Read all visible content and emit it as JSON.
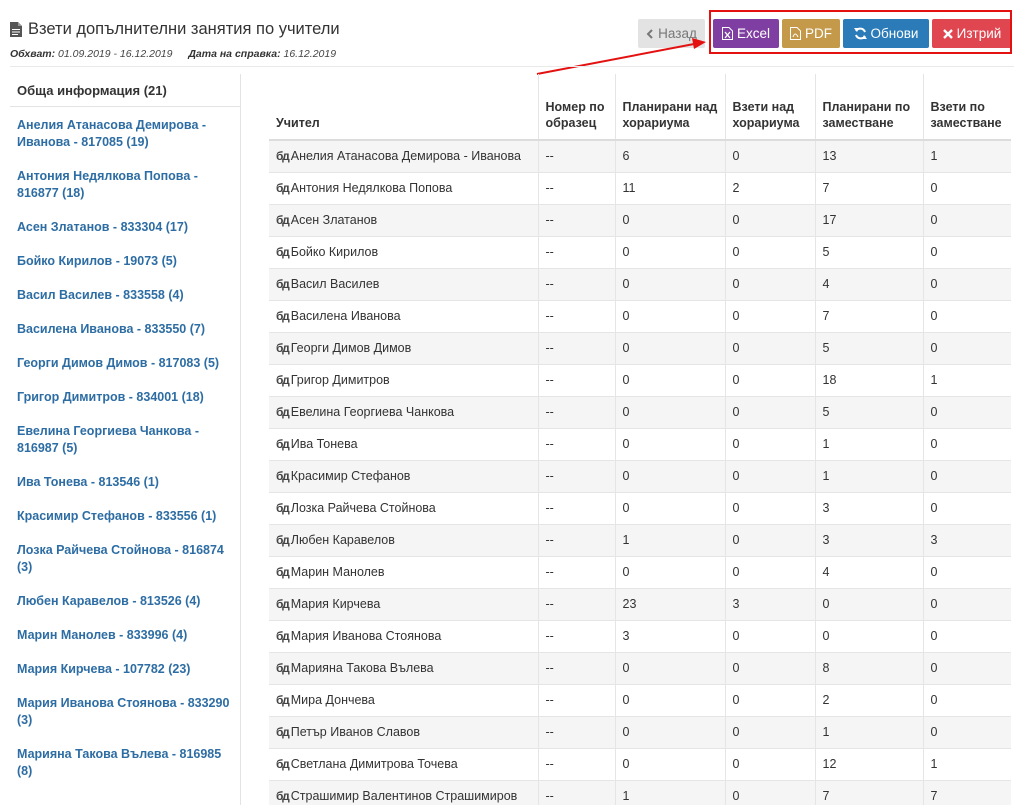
{
  "page": {
    "title": "Взети допълнителни занятия по учители",
    "range_label": "Обхват:",
    "range_value": "01.09.2019 - 16.12.2019",
    "date_label": "Дата на справка:",
    "date_value": "16.12.2019"
  },
  "toolbar": {
    "back_label": "Назад",
    "excel_label": "Excel",
    "pdf_label": "PDF",
    "refresh_label": "Обнови",
    "delete_label": "Изтрий"
  },
  "sidebar": {
    "header": "Обща информация (21)",
    "items": [
      "Анелия Атанасова Демирова - Иванова - 817085 (19)",
      "Антония Недялкова Попова - 816877 (18)",
      "Асен Златанов - 833304 (17)",
      "Бойко Кирилов - 19073 (5)",
      "Васил Василев - 833558 (4)",
      "Василена Иванова - 833550 (7)",
      "Георги Димов Димов - 817083 (5)",
      "Григор Димитров - 834001 (18)",
      "Евелина Георгиева Чанкова - 816987 (5)",
      "Ива Тонева - 813546 (1)",
      "Красимир Стефанов - 833556 (1)",
      "Лозка Райчева Стойнова - 816874 (3)",
      "Любен Каравелов - 813526 (4)",
      "Марин Манолев - 833996 (4)",
      "Мария Кирчева - 107782 (23)",
      "Мария Иванова Стоянова - 833290 (3)",
      "Марияна Такова Вълева - 816985 (8)"
    ]
  },
  "table": {
    "columns": [
      "Учител",
      "Номер по образец",
      "Планирани над хорариума",
      "Взети над хорариума",
      "Планирани по заместване",
      "Взети по заместване"
    ],
    "rows": [
      [
        "Анелия Атанасова Демирова - Иванова",
        "--",
        "6",
        "0",
        "13",
        "1"
      ],
      [
        "Антония Недялкова Попова",
        "--",
        "11",
        "2",
        "7",
        "0"
      ],
      [
        "Асен Златанов",
        "--",
        "0",
        "0",
        "17",
        "0"
      ],
      [
        "Бойко Кирилов",
        "--",
        "0",
        "0",
        "5",
        "0"
      ],
      [
        "Васил Василев",
        "--",
        "0",
        "0",
        "4",
        "0"
      ],
      [
        "Василена Иванова",
        "--",
        "0",
        "0",
        "7",
        "0"
      ],
      [
        "Георги Димов Димов",
        "--",
        "0",
        "0",
        "5",
        "0"
      ],
      [
        "Григор Димитров",
        "--",
        "0",
        "0",
        "18",
        "1"
      ],
      [
        "Евелина Георгиева Чанкова",
        "--",
        "0",
        "0",
        "5",
        "0"
      ],
      [
        "Ива Тонева",
        "--",
        "0",
        "0",
        "1",
        "0"
      ],
      [
        "Красимир Стефанов",
        "--",
        "0",
        "0",
        "1",
        "0"
      ],
      [
        "Лозка Райчева Стойнова",
        "--",
        "0",
        "0",
        "3",
        "0"
      ],
      [
        "Любен Каравелов",
        "--",
        "1",
        "0",
        "3",
        "3"
      ],
      [
        "Марин Манолев",
        "--",
        "0",
        "0",
        "4",
        "0"
      ],
      [
        "Мария Кирчева",
        "--",
        "23",
        "3",
        "0",
        "0"
      ],
      [
        "Мария Иванова Стоянова",
        "--",
        "3",
        "0",
        "0",
        "0"
      ],
      [
        "Марияна Такова Вълева",
        "--",
        "0",
        "0",
        "8",
        "0"
      ],
      [
        "Мира Дончева",
        "--",
        "0",
        "0",
        "2",
        "0"
      ],
      [
        "Петър Иванов Славов",
        "--",
        "0",
        "0",
        "1",
        "0"
      ],
      [
        "Светлана Димитрова Точева",
        "--",
        "0",
        "0",
        "12",
        "1"
      ],
      [
        "Страшимир Валентинов Страшимиров",
        "--",
        "1",
        "0",
        "7",
        "7"
      ]
    ]
  },
  "icons": {
    "teacher_icon_text": "бд"
  },
  "colors": {
    "excel": "#7f3fa2",
    "pdf": "#c49a4a",
    "refresh": "#2b7bb9",
    "delete": "#e04650",
    "link": "#2d6da3",
    "annotation": "#e41111"
  }
}
